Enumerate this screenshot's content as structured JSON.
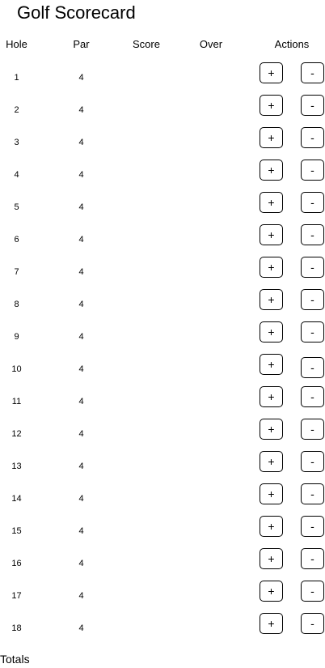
{
  "title": "Golf Scorecard",
  "headers": {
    "hole": "Hole",
    "par": "Par",
    "score": "Score",
    "over": "Over",
    "actions": "Actions"
  },
  "buttons": {
    "plus": "+",
    "minus": "-"
  },
  "holes": [
    {
      "hole": "1",
      "par": "4",
      "score": "",
      "over": ""
    },
    {
      "hole": "2",
      "par": "4",
      "score": "",
      "over": ""
    },
    {
      "hole": "3",
      "par": "4",
      "score": "",
      "over": ""
    },
    {
      "hole": "4",
      "par": "4",
      "score": "",
      "over": ""
    },
    {
      "hole": "5",
      "par": "4",
      "score": "",
      "over": ""
    },
    {
      "hole": "6",
      "par": "4",
      "score": "",
      "over": ""
    },
    {
      "hole": "7",
      "par": "4",
      "score": "",
      "over": ""
    },
    {
      "hole": "8",
      "par": "4",
      "score": "",
      "over": ""
    },
    {
      "hole": "9",
      "par": "4",
      "score": "",
      "over": ""
    },
    {
      "hole": "10",
      "par": "4",
      "score": "",
      "over": ""
    },
    {
      "hole": "11",
      "par": "4",
      "score": "",
      "over": ""
    },
    {
      "hole": "12",
      "par": "4",
      "score": "",
      "over": ""
    },
    {
      "hole": "13",
      "par": "4",
      "score": "",
      "over": ""
    },
    {
      "hole": "14",
      "par": "4",
      "score": "",
      "over": ""
    },
    {
      "hole": "15",
      "par": "4",
      "score": "",
      "over": ""
    },
    {
      "hole": "16",
      "par": "4",
      "score": "",
      "over": ""
    },
    {
      "hole": "17",
      "par": "4",
      "score": "",
      "over": ""
    },
    {
      "hole": "18",
      "par": "4",
      "score": "",
      "over": ""
    }
  ],
  "totals_label": "Totals"
}
